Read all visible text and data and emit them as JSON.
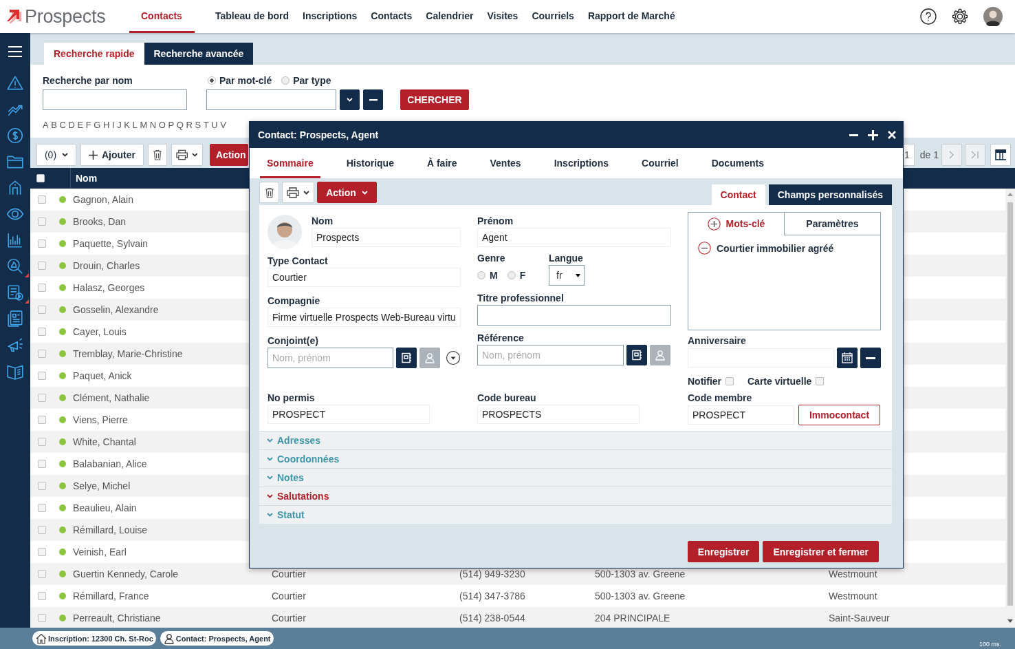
{
  "app": {
    "logo": "Prospects"
  },
  "nav": [
    {
      "label": "Contacts",
      "selected": true
    },
    {
      "label": "Tableau de bord",
      "selected": false
    },
    {
      "label": "Inscriptions",
      "selected": false
    },
    {
      "label": "Contacts",
      "selected": false
    },
    {
      "label": "Calendrier",
      "selected": false
    },
    {
      "label": "Visites",
      "selected": false
    },
    {
      "label": "Courriels",
      "selected": false
    },
    {
      "label": "Rapport de Marché",
      "selected": false
    }
  ],
  "sidebar": [
    {
      "flagged": false
    },
    {
      "flagged": false
    },
    {
      "flagged": false
    },
    {
      "flagged": false
    },
    {
      "flagged": false
    },
    {
      "flagged": false
    },
    {
      "flagged": false
    },
    {
      "flagged": true
    },
    {
      "flagged": true
    },
    {
      "flagged": false
    },
    {
      "flagged": false
    },
    {
      "flagged": false
    }
  ],
  "search_tabs": [
    {
      "label": "Recherche rapide",
      "selected": true
    },
    {
      "label": "Recherche avancée",
      "selected": false
    }
  ],
  "search": {
    "name_label": "Recherche par nom",
    "modes": [
      {
        "label": "Par mot-clé",
        "selected": true
      },
      {
        "label": "Par type",
        "selected": false
      }
    ],
    "button": "CHERCHER",
    "letters": [
      "A",
      "B",
      "C",
      "D",
      "E",
      "F",
      "G",
      "H",
      "I",
      "J",
      "K",
      "L",
      "M",
      "N",
      "O",
      "P",
      "Q",
      "R",
      "S",
      "T",
      "U",
      "V"
    ]
  },
  "list_toolbar": {
    "count": "(0)",
    "add": "Ajouter",
    "action": "Action",
    "page": "1",
    "page_total": "de 1"
  },
  "table": {
    "all_checked": false,
    "columns": [
      "Nom"
    ],
    "rows": [
      {
        "name": "Gagnon, Alain",
        "checked": false,
        "color": "#8cc63f"
      },
      {
        "name": "Brooks, Dan",
        "checked": false,
        "color": "#8cc63f"
      },
      {
        "name": "Paquette, Sylvain",
        "checked": false,
        "color": "#8cc63f"
      },
      {
        "name": "Drouin, Charles",
        "checked": false,
        "color": "#8cc63f"
      },
      {
        "name": "Halasz, Georges",
        "checked": false,
        "color": "#8cc63f"
      },
      {
        "name": "Gosselin, Alexandre",
        "checked": false,
        "color": "#8cc63f"
      },
      {
        "name": "Cayer, Louis",
        "checked": false,
        "color": "#8cc63f"
      },
      {
        "name": "Tremblay, Marie-Christine",
        "checked": false,
        "color": "#8cc63f"
      },
      {
        "name": "Paquet, Anick",
        "checked": false,
        "color": "#8cc63f"
      },
      {
        "name": "Clément, Nathalie",
        "checked": false,
        "color": "#8cc63f"
      },
      {
        "name": "Viens, Pierre",
        "checked": false,
        "color": "#8cc63f"
      },
      {
        "name": "White, Chantal",
        "checked": false,
        "color": "#8cc63f"
      },
      {
        "name": "Balabanian, Alice",
        "checked": false,
        "color": "#8cc63f"
      },
      {
        "name": "Selye, Michel",
        "checked": false,
        "color": "#8cc63f"
      },
      {
        "name": "Beaulieu, Alain",
        "checked": false,
        "color": "#8cc63f"
      },
      {
        "name": "Rémillard, Louise",
        "checked": false,
        "color": "#8cc63f"
      },
      {
        "name": "Veinish, Earl",
        "checked": false,
        "color": "#8cc63f"
      },
      {
        "name": "Guertin Kennedy, Carole",
        "checked": false,
        "color": "#8cc63f",
        "cells": [
          "Courtier",
          "(514) 949-3230",
          "500-1303 av. Greene",
          "Westmount"
        ]
      },
      {
        "name": "Rémillard, France",
        "checked": false,
        "color": "#8cc63f",
        "cells": [
          "Courtier",
          "(514) 347-3786",
          "500-1303 av. Greene",
          "Westmount"
        ]
      },
      {
        "name": "Perreault, Christiane",
        "checked": false,
        "color": "#8cc63f",
        "cells": [
          "Courtier",
          "(514) 238-0544",
          "204 PRINCIPALE",
          "Saint-Sauveur"
        ]
      }
    ]
  },
  "modal": {
    "title": "Contact: Prospects, Agent",
    "tabs": [
      {
        "label": "Sommaire",
        "selected": true
      },
      {
        "label": "Historique",
        "selected": false
      },
      {
        "label": "À faire",
        "selected": false
      },
      {
        "label": "Ventes",
        "selected": false
      },
      {
        "label": "Inscriptions",
        "selected": false
      },
      {
        "label": "Courriel",
        "selected": false
      },
      {
        "label": "Documents",
        "selected": false
      }
    ],
    "action": "Action",
    "panel_tabs": [
      {
        "label": "Contact",
        "selected": true
      },
      {
        "label": "Champs personnalisés",
        "selected": false
      }
    ],
    "nom": {
      "label": "Nom",
      "value": "Prospects"
    },
    "prenom": {
      "label": "Prénom",
      "value": "Agent"
    },
    "type_contact": {
      "label": "Type Contact",
      "value": "Courtier"
    },
    "genre": {
      "label": "Genre",
      "options": [
        {
          "label": "M",
          "selected": false
        },
        {
          "label": "F",
          "selected": false
        }
      ]
    },
    "langue": {
      "label": "Langue",
      "value": "fr"
    },
    "compagnie": {
      "label": "Compagnie",
      "value": "Firme virtuelle Prospects Web-Bureau virtu"
    },
    "titre": {
      "label": "Titre professionnel"
    },
    "conjoint": {
      "label": "Conjoint(e)",
      "placeholder": "Nom, prénom"
    },
    "reference": {
      "label": "Référence",
      "placeholder": "Nom, prénom"
    },
    "keyword_tabs": [
      {
        "label": "Mots-clé",
        "selected": true
      },
      {
        "label": "Paramètres",
        "selected": false
      }
    ],
    "keywords": [
      "Courtier immobilier agréé"
    ],
    "anniversaire": {
      "label": "Anniversaire"
    },
    "flags": [
      {
        "label": "Notifier",
        "checked": false
      },
      {
        "label": "Carte virtuelle",
        "checked": false
      }
    ],
    "no_permis": {
      "label": "No permis",
      "value": "PROSPECT"
    },
    "code_bureau": {
      "label": "Code bureau",
      "value": "PROSPECTS"
    },
    "code_membre": {
      "label": "Code membre",
      "value": "PROSPECT"
    },
    "immocontact": "Immocontact",
    "sections": [
      {
        "label": "Adresses",
        "highlighted": false
      },
      {
        "label": "Coordonnées",
        "highlighted": false
      },
      {
        "label": "Notes",
        "highlighted": false
      },
      {
        "label": "Salutations",
        "highlighted": true
      },
      {
        "label": "Statut",
        "highlighted": false
      }
    ],
    "buttons": [
      "Enregistrer",
      "Enregistrer et fermer"
    ]
  },
  "status_bar": {
    "tabs": [
      {
        "label": "Inscription: 12300 Ch. St-Roc",
        "kind": "listing"
      },
      {
        "label": "Contact: Prospects, Agent",
        "kind": "contact"
      }
    ],
    "timing": "100 ms."
  }
}
